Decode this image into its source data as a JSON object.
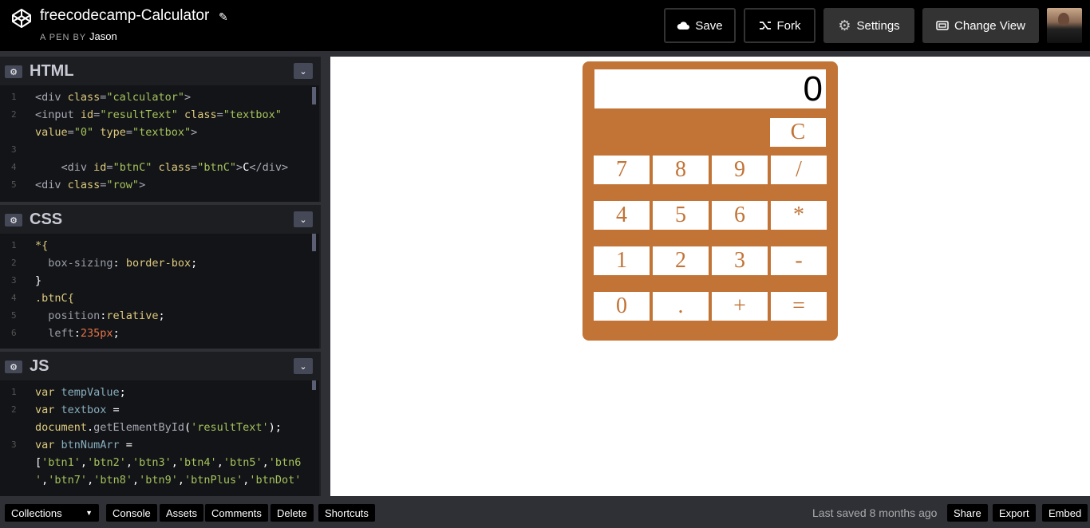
{
  "header": {
    "title": "freecodecamp-Calculator",
    "pen_by": "A PEN BY",
    "author": "Jason",
    "buttons": {
      "save": "Save",
      "fork": "Fork",
      "settings": "Settings",
      "change_view": "Change View"
    }
  },
  "editors": {
    "html": {
      "title": "HTML",
      "lines": [
        {
          "n": "1",
          "parts": [
            [
              "tag",
              "<div "
            ],
            [
              "attr",
              "class"
            ],
            [
              "tag",
              "="
            ],
            [
              "val",
              "\"calculator\""
            ],
            [
              "tag",
              ">"
            ]
          ]
        },
        {
          "n": "2",
          "parts": [
            [
              "tag",
              "<input "
            ],
            [
              "attr",
              "id"
            ],
            [
              "tag",
              "="
            ],
            [
              "val",
              "\"resultText\""
            ],
            [
              "tag",
              " "
            ],
            [
              "attr",
              "class"
            ],
            [
              "tag",
              "="
            ],
            [
              "val",
              "\"textbox\""
            ]
          ]
        },
        {
          "n": "",
          "parts": [
            [
              "attr",
              "value"
            ],
            [
              "tag",
              "="
            ],
            [
              "val",
              "\"0\""
            ],
            [
              "tag",
              " "
            ],
            [
              "attr",
              "type"
            ],
            [
              "tag",
              "="
            ],
            [
              "val",
              "\"textbox\""
            ],
            [
              "tag",
              ">"
            ]
          ]
        },
        {
          "n": "3",
          "parts": []
        },
        {
          "n": "4",
          "parts": [
            [
              "tag",
              "    <div "
            ],
            [
              "attr",
              "id"
            ],
            [
              "tag",
              "="
            ],
            [
              "val",
              "\"btnC\""
            ],
            [
              "tag",
              " "
            ],
            [
              "attr",
              "class"
            ],
            [
              "tag",
              "="
            ],
            [
              "val",
              "\"btnC\""
            ],
            [
              "tag",
              ">"
            ],
            [
              "txt",
              "C"
            ],
            [
              "tag",
              "</div>"
            ]
          ]
        },
        {
          "n": "5",
          "parts": [
            [
              "tag",
              "<div "
            ],
            [
              "attr",
              "class"
            ],
            [
              "tag",
              "="
            ],
            [
              "val",
              "\"row\""
            ],
            [
              "tag",
              ">"
            ]
          ]
        }
      ]
    },
    "css": {
      "title": "CSS",
      "lines": [
        {
          "n": "1",
          "parts": [
            [
              "sel",
              "*{"
            ]
          ]
        },
        {
          "n": "2",
          "parts": [
            [
              "prop",
              "  box-sizing"
            ],
            [
              "txt",
              ": "
            ],
            [
              "sel",
              "border-box"
            ],
            [
              "txt",
              ";"
            ]
          ]
        },
        {
          "n": "3",
          "parts": [
            [
              "txt",
              "}"
            ]
          ]
        },
        {
          "n": "4",
          "parts": [
            [
              "sel",
              ".btnC{"
            ]
          ]
        },
        {
          "n": "5",
          "parts": [
            [
              "prop",
              "  position"
            ],
            [
              "txt",
              ":"
            ],
            [
              "sel",
              "relative"
            ],
            [
              "txt",
              ";"
            ]
          ]
        },
        {
          "n": "6",
          "parts": [
            [
              "prop",
              "  left"
            ],
            [
              "txt",
              ":"
            ],
            [
              "num",
              "235px"
            ],
            [
              "txt",
              ";"
            ]
          ]
        }
      ]
    },
    "js": {
      "title": "JS",
      "lines": [
        {
          "n": "1",
          "parts": [
            [
              "kw",
              "var "
            ],
            [
              "var",
              "tempValue"
            ],
            [
              "txt",
              ";"
            ]
          ]
        },
        {
          "n": "2",
          "parts": [
            [
              "kw",
              "var "
            ],
            [
              "var",
              "textbox"
            ],
            [
              "txt",
              " ="
            ]
          ]
        },
        {
          "n": "",
          "parts": [
            [
              "kw",
              "document"
            ],
            [
              "txt",
              "."
            ],
            [
              "fn",
              "getElementById"
            ],
            [
              "txt",
              "("
            ],
            [
              "str",
              "'resultText'"
            ],
            [
              "txt",
              ");"
            ]
          ]
        },
        {
          "n": "3",
          "parts": [
            [
              "kw",
              "var "
            ],
            [
              "var",
              "btnNumArr"
            ],
            [
              "txt",
              " ="
            ]
          ]
        },
        {
          "n": "",
          "parts": [
            [
              "txt",
              "["
            ],
            [
              "str",
              "'btn1'"
            ],
            [
              "txt",
              ","
            ],
            [
              "str",
              "'btn2'"
            ],
            [
              "txt",
              ","
            ],
            [
              "str",
              "'btn3'"
            ],
            [
              "txt",
              ","
            ],
            [
              "str",
              "'btn4'"
            ],
            [
              "txt",
              ","
            ],
            [
              "str",
              "'btn5'"
            ],
            [
              "txt",
              ","
            ],
            [
              "str",
              "'btn6"
            ]
          ]
        },
        {
          "n": "",
          "parts": [
            [
              "str",
              "'"
            ],
            [
              "txt",
              ","
            ],
            [
              "str",
              "'btn7'"
            ],
            [
              "txt",
              ","
            ],
            [
              "str",
              "'btn8'"
            ],
            [
              "txt",
              ","
            ],
            [
              "str",
              "'btn9'"
            ],
            [
              "txt",
              ","
            ],
            [
              "str",
              "'btnPlus'"
            ],
            [
              "txt",
              ","
            ],
            [
              "str",
              "'btnDot'"
            ]
          ]
        }
      ]
    }
  },
  "calculator": {
    "display": "0",
    "clear": "C",
    "rows": [
      [
        "7",
        "8",
        "9",
        "/"
      ],
      [
        "4",
        "5",
        "6",
        "*"
      ],
      [
        "1",
        "2",
        "3",
        "-"
      ],
      [
        "0",
        ".",
        "+",
        "="
      ]
    ],
    "accent": "#c27336"
  },
  "footer": {
    "collections": "Collections",
    "console": "Console",
    "assets": "Assets",
    "comments": "Comments",
    "delete": "Delete",
    "shortcuts": "Shortcuts",
    "last_saved": "Last saved 8 months ago",
    "share": "Share",
    "export": "Export",
    "embed": "Embed"
  }
}
